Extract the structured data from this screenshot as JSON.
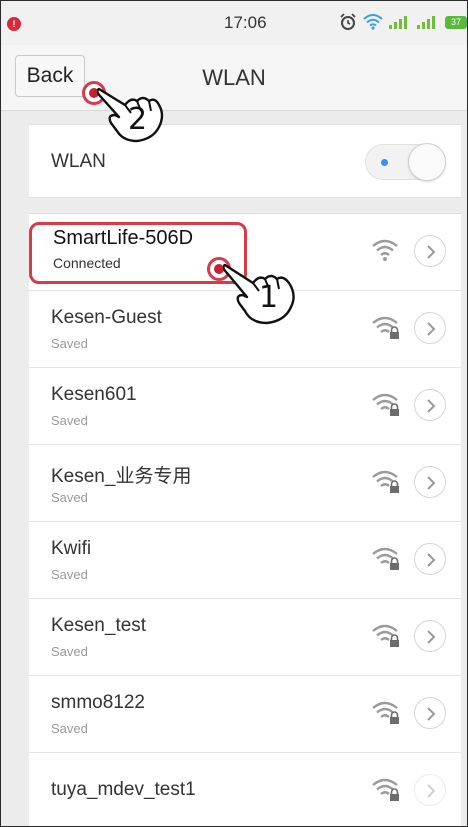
{
  "status_bar": {
    "alert_icon": "notification-dot-icon",
    "time": "17:06",
    "battery": "37",
    "icons": [
      "alarm-icon",
      "wifi-icon",
      "signal-icon",
      "signal-icon",
      "battery-icon"
    ]
  },
  "header": {
    "back_label": "Back",
    "title": "WLAN"
  },
  "wlan_toggle": {
    "label": "WLAN",
    "state": "on"
  },
  "networks": [
    {
      "name": "SmartLife-506D",
      "status": "Connected",
      "secured": false,
      "connected": true
    },
    {
      "name": "Kesen-Guest",
      "status": "Saved",
      "secured": true
    },
    {
      "name": "Kesen601",
      "status": "Saved",
      "secured": true
    },
    {
      "name": "Kesen_业务专用",
      "status": "Saved",
      "secured": true
    },
    {
      "name": "Kwifi",
      "status": "Saved",
      "secured": true
    },
    {
      "name": "Kesen_test",
      "status": "Saved",
      "secured": true
    },
    {
      "name": "smmo8122",
      "status": "Saved",
      "secured": true
    },
    {
      "name": "tuya_mdev_test1",
      "status": "",
      "secured": true
    }
  ],
  "annotations": {
    "step1": "1",
    "step2": "2"
  },
  "colors": {
    "highlight": "#d93a4a",
    "toggle_led": "#3b8df2",
    "battery": "#58b93c"
  }
}
